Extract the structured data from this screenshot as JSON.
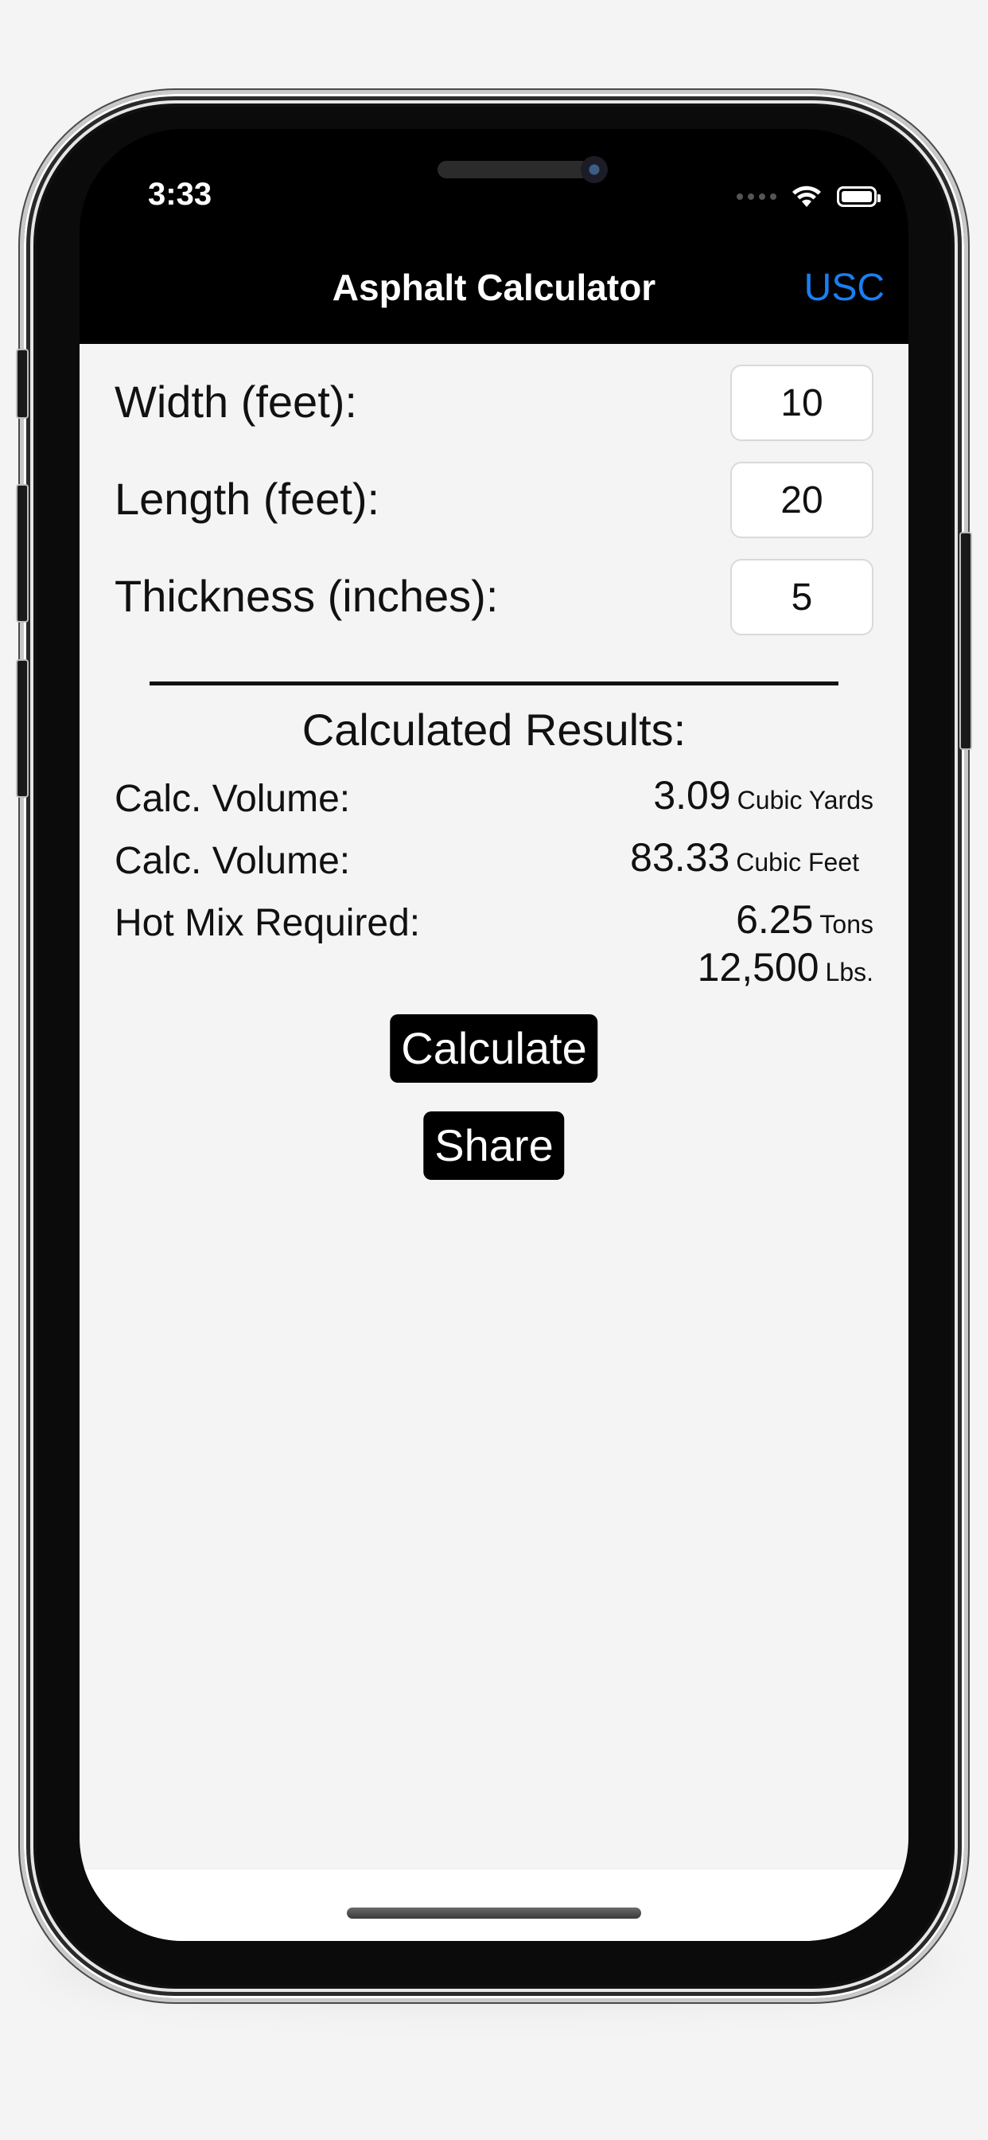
{
  "status_bar": {
    "time": "3:33"
  },
  "nav": {
    "title": "Asphalt Calculator",
    "unit_toggle": "USC"
  },
  "inputs": [
    {
      "label": "Width (feet):",
      "value": "10"
    },
    {
      "label": "Length (feet):",
      "value": "20"
    },
    {
      "label": "Thickness (inches):",
      "value": "5"
    }
  ],
  "results": {
    "title": "Calculated Results:",
    "rows": [
      {
        "label": "Calc. Volume:",
        "value": "3.09",
        "unit": "Cubic Yards"
      },
      {
        "label": "Calc. Volume:",
        "value": "83.33",
        "unit": "Cubic Feet"
      },
      {
        "label": "Hot Mix Required:",
        "value": "6.25",
        "unit": "Tons"
      }
    ],
    "extra": {
      "value": "12,500",
      "unit": "Lbs."
    }
  },
  "buttons": {
    "calculate": "Calculate",
    "share": "Share"
  },
  "colors": {
    "accent": "#1a7ef2",
    "background": "#f4f4f4",
    "navbar": "#000000"
  }
}
